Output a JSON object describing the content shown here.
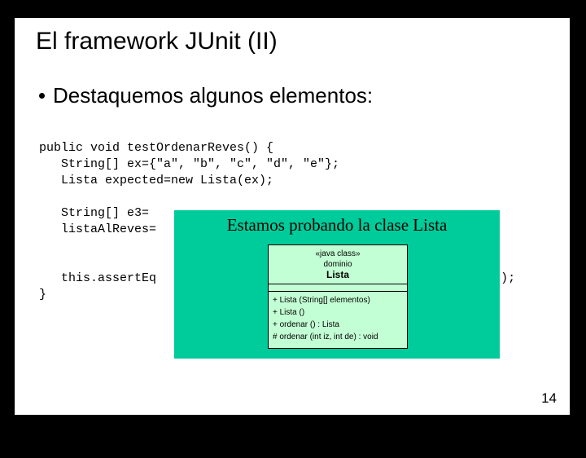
{
  "title": "El framework JUnit (II)",
  "bullet": "Destaquemos algunos elementos:",
  "code": {
    "l1": "public void testOrdenarReves() {",
    "l2": "   String[] ex={\"a\", \"b\", \"c\", \"d\", \"e\"};",
    "l3": "   Lista expected=new Lista(ex);",
    "l4": "",
    "l5": "   String[] e3=",
    "l6": "   listaAlReves=",
    "l7": "",
    "l8": "",
    "l9": "   this.assertEq",
    "l9tail": ");",
    "l10": "}"
  },
  "callout": {
    "text": "Estamos probando la clase Lista"
  },
  "uml": {
    "stereotype": "«java class»",
    "package": "dominio",
    "name": "Lista",
    "op1": "+ Lista (String[] elementos)",
    "op2": "+ Lista ()",
    "op3": "+ ordenar () : Lista",
    "op4": "# ordenar (int iz, int de) : void"
  },
  "page": "14"
}
